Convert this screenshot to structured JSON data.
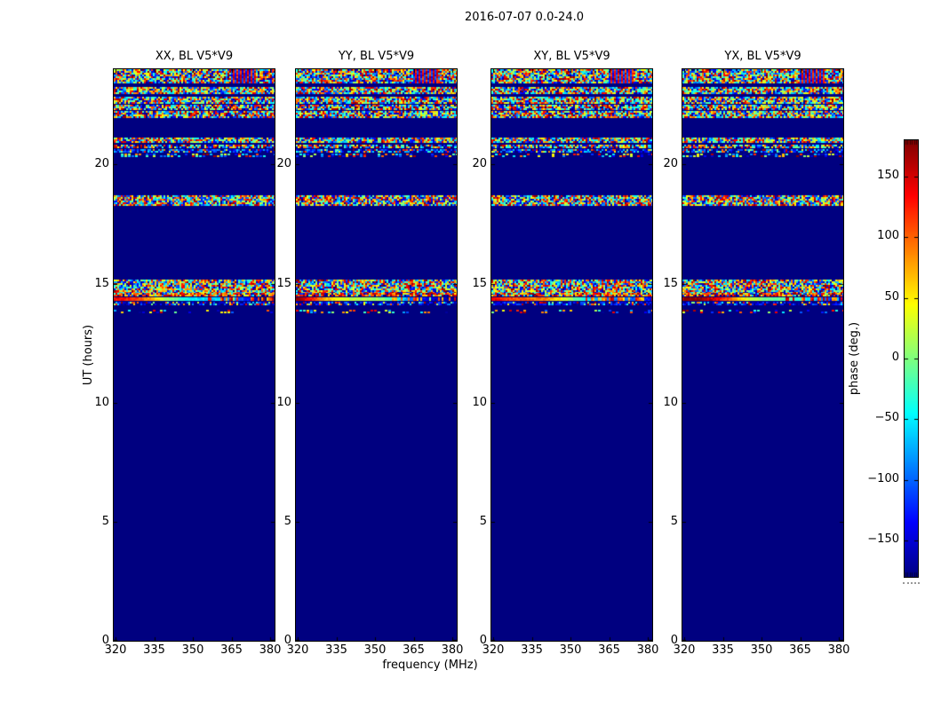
{
  "figure": {
    "title": "2016-07-07 0.0-24.0",
    "background_color": "#ffffff",
    "text_color": "#000000",
    "frame_color": "#000000"
  },
  "chart_data": {
    "type": "heatmap",
    "title": "2016-07-07 0.0-24.0",
    "description": "Four phase-vs-frequency-vs-time waterfall panels for baseline V5*V9, one per polarization product; deep navy background is quiet phase, noisy multicolor horizontal bands mark times with measured phase",
    "panels": [
      {
        "title": "XX, BL V5*V9",
        "pol": "XX",
        "baseline": "V5*V9"
      },
      {
        "title": "YY, BL V5*V9",
        "pol": "YY",
        "baseline": "V5*V9"
      },
      {
        "title": "XY, BL V5*V9",
        "pol": "XY",
        "baseline": "V5*V9"
      },
      {
        "title": "YX, BL V5*V9",
        "pol": "YX",
        "baseline": "V5*V9"
      }
    ],
    "xlabel": "frequency (MHz)",
    "ylabel": "UT (hours)",
    "x_ticks": [
      {
        "v": 320,
        "label": "320"
      },
      {
        "v": 335,
        "label": "335"
      },
      {
        "v": 350,
        "label": "350"
      },
      {
        "v": 365,
        "label": "365"
      },
      {
        "v": 380,
        "label": "380"
      }
    ],
    "x_range": [
      319.3,
      381.7
    ],
    "y_ticks": [
      {
        "v": 0,
        "label": "0"
      },
      {
        "v": 5,
        "label": "5"
      },
      {
        "v": 10,
        "label": "10"
      },
      {
        "v": 15,
        "label": "15"
      },
      {
        "v": 20,
        "label": "20"
      }
    ],
    "y_range": [
      0,
      24
    ],
    "colorbar": {
      "label": "phase (deg.)",
      "colormap": "jet",
      "range": [
        -180,
        180
      ],
      "ticks": [
        {
          "v": 150,
          "label": "150"
        },
        {
          "v": 100,
          "label": "100"
        },
        {
          "v": 50,
          "label": "50"
        },
        {
          "v": 0,
          "label": "0"
        },
        {
          "v": -50,
          "label": "−50"
        },
        {
          "v": -100,
          "label": "−100"
        },
        {
          "v": -150,
          "label": "−150"
        }
      ]
    },
    "background_value_color": "#000080",
    "bands": [
      {
        "t0": 23.45,
        "t1": 24.0,
        "style": "noise",
        "density": 1.0,
        "stripe": [
          0.72,
          0.88
        ]
      },
      {
        "t0": 23.0,
        "t1": 23.25,
        "style": "noise",
        "density": 1.0
      },
      {
        "t0": 22.55,
        "t1": 22.85,
        "style": "noise",
        "density": 1.0
      },
      {
        "t0": 22.33,
        "t1": 22.5,
        "style": "noise",
        "density": 0.95
      },
      {
        "t0": 22.0,
        "t1": 22.25,
        "style": "noise",
        "density": 1.0
      },
      {
        "t0": 20.9,
        "t1": 21.12,
        "style": "noise",
        "density": 1.0
      },
      {
        "t0": 20.72,
        "t1": 20.85,
        "style": "noise",
        "density": 0.85
      },
      {
        "t0": 20.52,
        "t1": 20.66,
        "style": "noise-blue",
        "density": 0.8
      },
      {
        "t0": 20.36,
        "t1": 20.46,
        "style": "sparse",
        "density": 0.5
      },
      {
        "t0": 18.25,
        "t1": 18.72,
        "style": "noise",
        "density": 1.0
      },
      {
        "t0": 14.62,
        "t1": 15.17,
        "style": "noise",
        "density": 1.0
      },
      {
        "t0": 14.45,
        "t1": 14.6,
        "style": "noise-warm",
        "density": 0.9
      },
      {
        "t0": 14.3,
        "t1": 14.44,
        "style": "gradient",
        "density": 1.0
      },
      {
        "t0": 14.08,
        "t1": 14.24,
        "style": "noise-dark",
        "density": 0.7
      },
      {
        "t0": 13.78,
        "t1": 13.9,
        "style": "sparse",
        "density": 0.35
      }
    ]
  }
}
